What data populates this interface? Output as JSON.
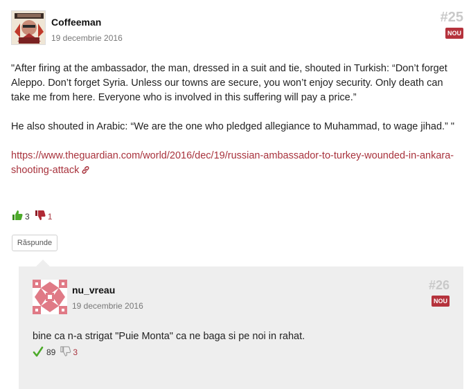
{
  "post1": {
    "author": "Coffeeman",
    "date": "19 decembrie 2016",
    "number": "#25",
    "badge": "NOU",
    "paragraph1": "\"After firing at the ambassador, the man, dressed in a suit and tie, shouted in Turkish: “Don’t forget Aleppo. Don’t forget Syria. Unless our towns are secure, you won’t enjoy security. Only death can take me from here. Everyone who is involved in this suffering will pay a price.”",
    "paragraph2": "He also shouted in Arabic: “We are the one who pledged allegiance to Muhammad, to wage jihad.” \"",
    "link": "https://www.theguardian.com/world/2016/dec/19/russian-ambassador-to-turkey-wounded-in-ankara-shooting-attack",
    "likes": "3",
    "dislikes": "1",
    "reply_label": "Răspunde"
  },
  "post2": {
    "author": "nu_vreau",
    "date": "19 decembrie 2016",
    "number": "#26",
    "badge": "NOU",
    "text": "bine ca n-a strigat \"Puie Monta\" ca ne baga si pe noi in rahat.",
    "agrees": "89",
    "dislikes": "3"
  },
  "icons": {
    "thumb_up": "thumbs-up-icon",
    "thumb_down": "thumbs-down-icon",
    "check": "check-icon",
    "link": "link-icon"
  },
  "colors": {
    "accent": "#a8323c",
    "badge": "#b5323c",
    "quote_bg": "#eeeeee",
    "post_number": "#c9c9c9"
  }
}
